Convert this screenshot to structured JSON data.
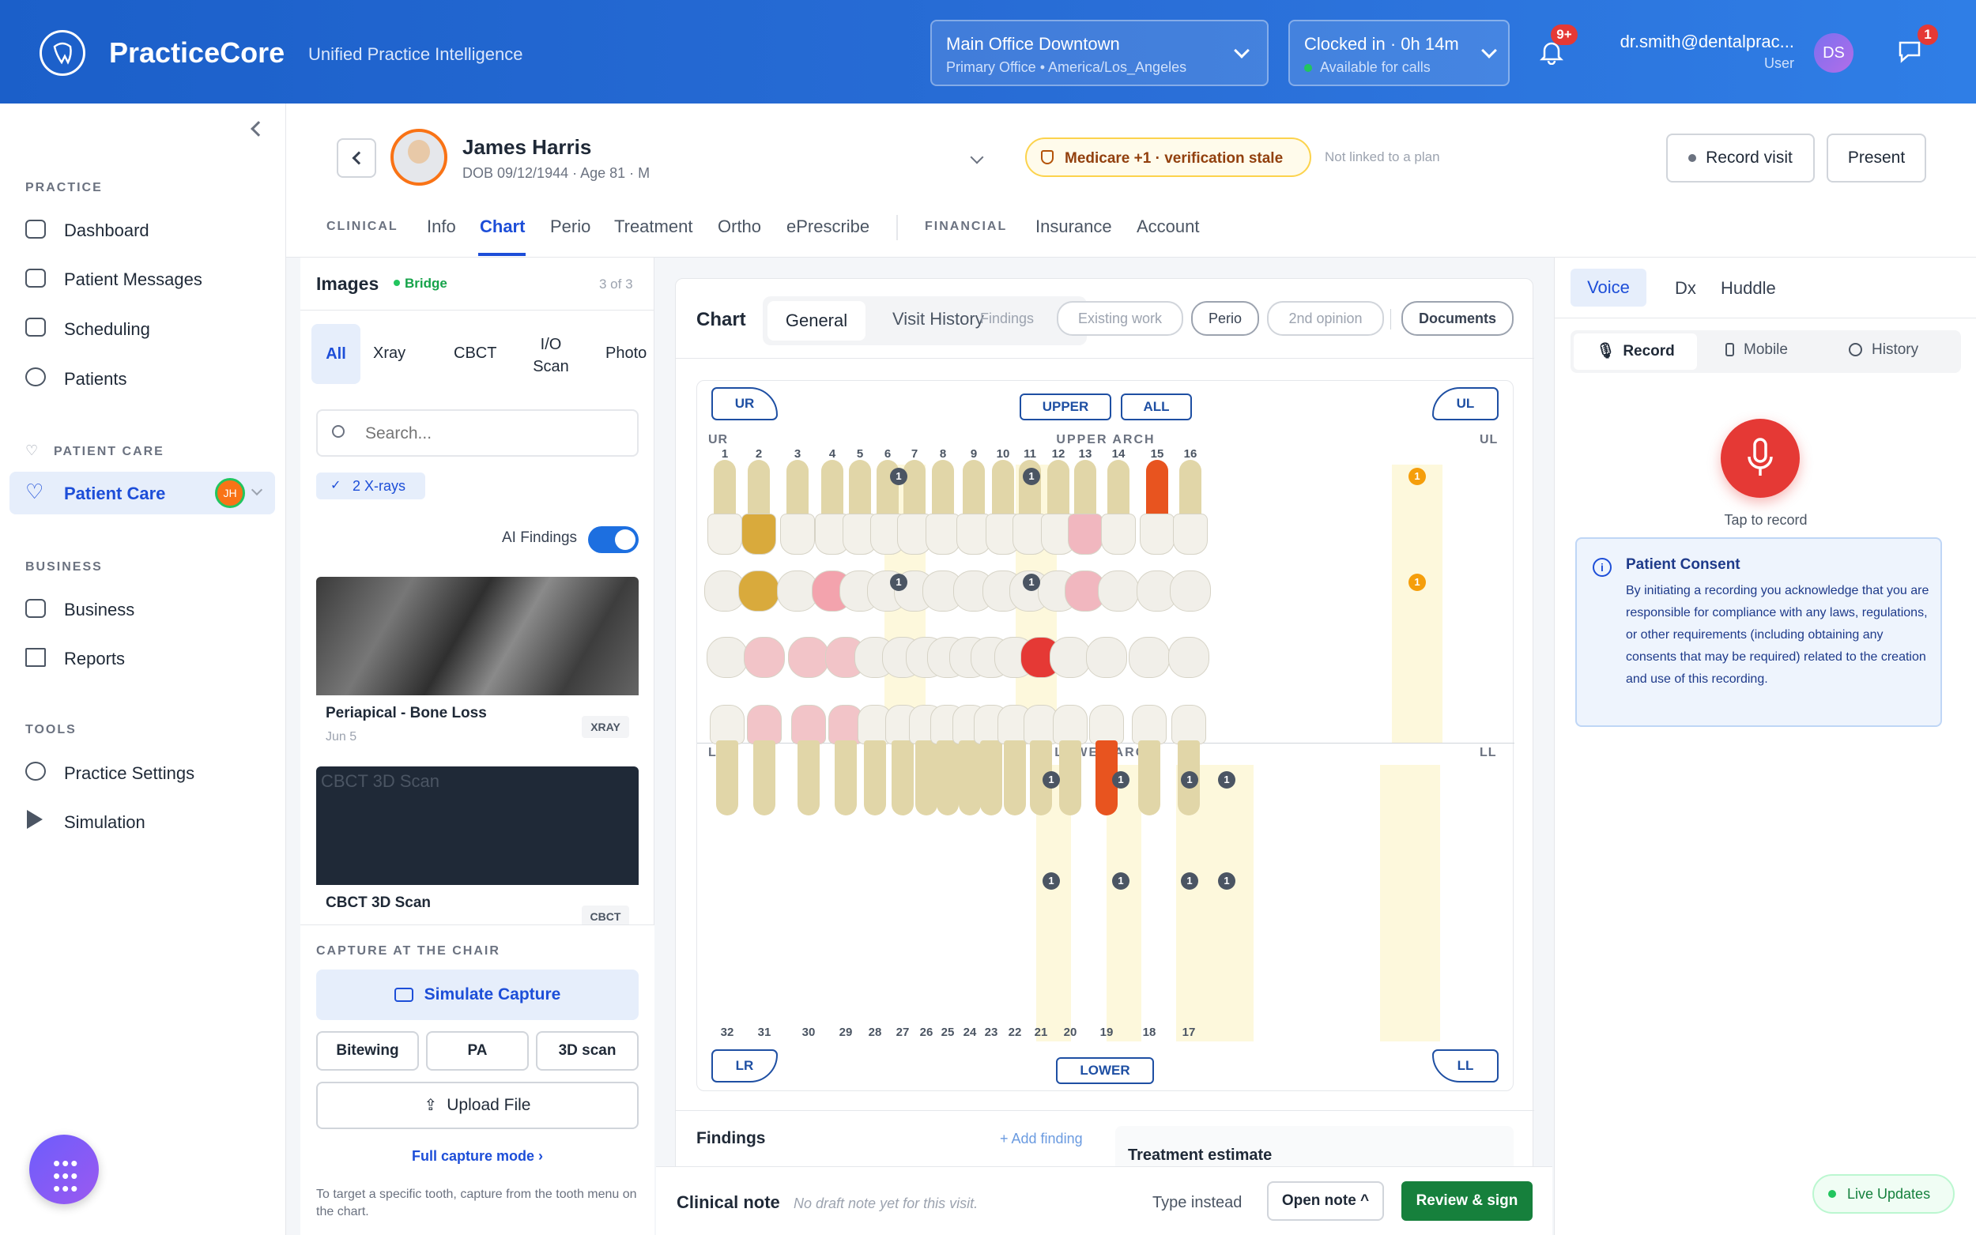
{
  "header": {
    "brand": "PracticeCore",
    "tagline": "Unified Practice Intelligence",
    "location": {
      "title": "Main Office Downtown",
      "subtitle": "Primary Office • America/Los_Angeles"
    },
    "clock": {
      "title": "Clocked in · 0h 14m",
      "subtitle": "Available for calls"
    },
    "notif_badge": "9+",
    "user_email": "dr.smith@dentalprac...",
    "user_role": "User",
    "user_initials": "DS",
    "messages_badge": "1"
  },
  "sidebar": {
    "sections": {
      "practice": "PRACTICE",
      "patient_care": "PATIENT CARE",
      "business": "BUSINESS",
      "tools": "TOOLS"
    },
    "items": {
      "dashboard": "Dashboard",
      "messages": "Patient Messages",
      "scheduling": "Scheduling",
      "patients": "Patients",
      "patient_care": "Patient Care",
      "patient_care_initials": "JH",
      "business": "Business",
      "reports": "Reports",
      "settings": "Practice Settings",
      "simulation": "Simulation"
    }
  },
  "patient": {
    "name": "James Harris",
    "dob": "DOB 09/12/1944 · Age 81 · M",
    "insurance": "Medicare +1 · verification stale",
    "plan": "Not linked to a plan"
  },
  "actions": {
    "record_visit": "Record visit",
    "present": "Present"
  },
  "tabs": {
    "clinical": "CLINICAL",
    "info": "Info",
    "chart": "Chart",
    "perio": "Perio",
    "treatment": "Treatment",
    "ortho": "Ortho",
    "eprescribe": "ePrescribe",
    "financial": "FINANCIAL",
    "insurance": "Insurance",
    "account": "Account"
  },
  "images": {
    "title": "Images",
    "bridge": "Bridge",
    "count": "3 of 3",
    "filters": [
      "All",
      "Xray",
      "CBCT",
      "I/O\nScan",
      "Photo"
    ],
    "search_placeholder": "Search...",
    "chip": "2 X-rays",
    "ai_findings": "AI Findings",
    "cards": [
      {
        "title": "Periapical - Bone Loss",
        "date": "Jun 5",
        "tag": "XRAY"
      },
      {
        "title": "CBCT 3D Scan",
        "alt": "CBCT 3D Scan",
        "tag": "CBCT"
      }
    ],
    "capture_title": "CAPTURE AT THE CHAIR",
    "simulate": "Simulate Capture",
    "capture_buttons": [
      "Bitewing",
      "PA",
      "3D scan"
    ],
    "upload": "Upload File",
    "full_mode": "Full capture mode ›",
    "hint": "To target a specific tooth, capture from the tooth menu on the chart."
  },
  "chart": {
    "title": "Chart",
    "view_tabs": {
      "general": "General",
      "visit_history": "Visit History"
    },
    "pills": [
      "Findings",
      "Existing work",
      "Perio",
      "2nd opinion",
      "Documents"
    ],
    "quadrants": {
      "ur": "UR",
      "ul": "UL",
      "lr": "LR",
      "ll": "LL"
    },
    "arch_buttons": {
      "upper": "UPPER",
      "all": "ALL",
      "lower": "LOWER"
    },
    "upper_arch": "UPPER ARCH",
    "lower_arch": "LOWER ARCH",
    "upper_numbers": [
      "1",
      "2",
      "3",
      "4",
      "5",
      "6",
      "7",
      "8",
      "9",
      "10",
      "11",
      "12",
      "13",
      "14",
      "15",
      "16"
    ],
    "lower_numbers": [
      "32",
      "31",
      "30",
      "29",
      "28",
      "27",
      "26",
      "25",
      "24",
      "23",
      "22",
      "21",
      "20",
      "19",
      "18",
      "17"
    ],
    "findings_title": "Findings",
    "add_finding": "+ Add finding",
    "treatment_estimate": "Treatment estimate"
  },
  "right": {
    "tabs": [
      "Voice",
      "Dx",
      "Huddle"
    ],
    "subtabs": [
      "Record",
      "Mobile",
      "History"
    ],
    "tap": "Tap to record",
    "consent_title": "Patient Consent",
    "consent_text": "By initiating a recording you acknowledge that you are responsible for compliance with any laws, regulations, or other requirements (including obtaining any consents that may be required) related to the creation and use of this recording.",
    "live": "Live Updates"
  },
  "note": {
    "title": "Clinical note",
    "status": "No draft note yet for this visit.",
    "type_instead": "Type instead",
    "open_note": "Open note ^",
    "review": "Review & sign"
  }
}
